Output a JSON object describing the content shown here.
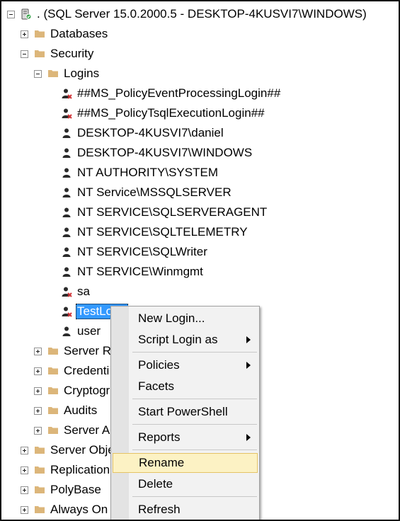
{
  "tree": {
    "server_label": ". (SQL Server 15.0.2000.5 - DESKTOP-4KUSVI7\\WINDOWS)",
    "databases": "Databases",
    "security": "Security",
    "logins": "Logins",
    "login_items": [
      "##MS_PolicyEventProcessingLogin##",
      "##MS_PolicyTsqlExecutionLogin##",
      "DESKTOP-4KUSVI7\\daniel",
      "DESKTOP-4KUSVI7\\WINDOWS",
      "NT AUTHORITY\\SYSTEM",
      "NT Service\\MSSQLSERVER",
      "NT SERVICE\\SQLSERVERAGENT",
      "NT SERVICE\\SQLTELEMETRY",
      "NT SERVICE\\SQLWriter",
      "NT SERVICE\\Winmgmt",
      "sa",
      "TestLo",
      "user"
    ],
    "security_children": [
      "Server Ro",
      "Credenti",
      "Cryptogr",
      "Audits",
      "Server Au"
    ],
    "server_children": [
      "Server Obje",
      "Replication",
      "PolyBase",
      "Always On"
    ]
  },
  "context_menu": {
    "new_login": "New Login...",
    "script_login_as": "Script Login as",
    "policies": "Policies",
    "facets": "Facets",
    "start_powershell": "Start PowerShell",
    "reports": "Reports",
    "rename": "Rename",
    "delete": "Delete",
    "refresh": "Refresh"
  },
  "icons": {
    "server": "server-icon",
    "folder": "folder-icon",
    "login": "login-user-icon",
    "disabled_login": "disabled-login-icon"
  },
  "colors": {
    "selection": "#3399ff",
    "menu_hover": "#fcf2c4",
    "menu_hover_border": "#e5c365",
    "folder": "#dcb67a"
  }
}
